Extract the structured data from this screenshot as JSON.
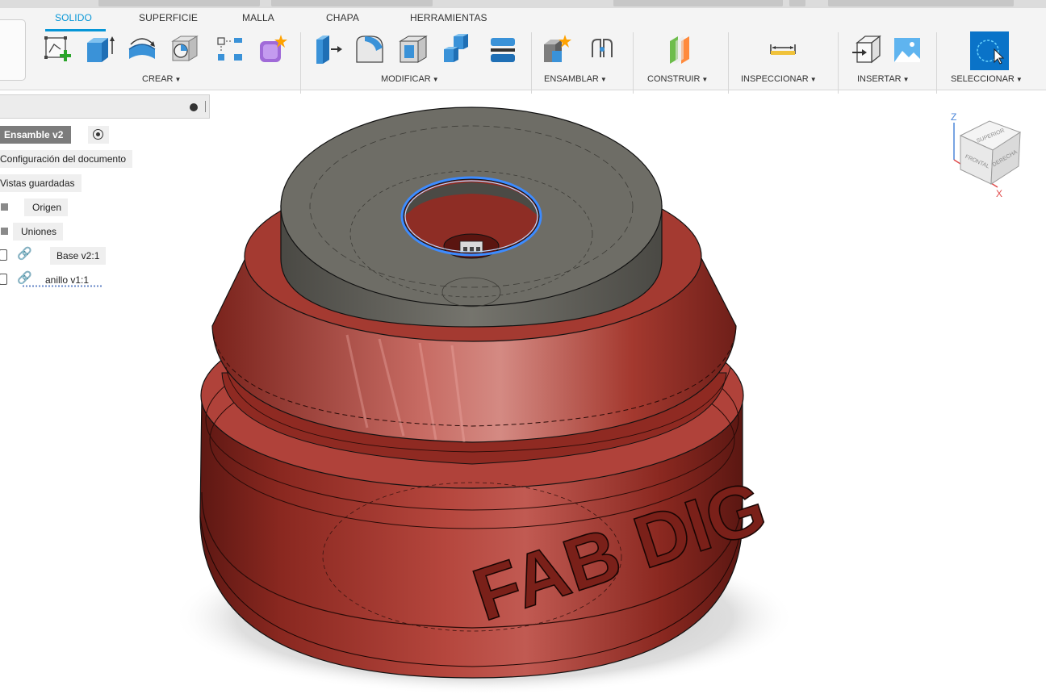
{
  "workspace_tabs": [
    "SOLIDO",
    "SUPERFICIE",
    "MALLA",
    "CHAPA",
    "HERRAMIENTAS"
  ],
  "active_tab": "SOLIDO",
  "groups": {
    "crear": "CREAR",
    "modificar": "MODIFICAR",
    "ensamblar": "ENSAMBLAR",
    "construir": "CONSTRUIR",
    "inspeccionar": "INSPECCIONAR",
    "insertar": "INSERTAR",
    "seleccionar": "SELECCIONAR"
  },
  "caret": "▼",
  "browser": {
    "root": "Ensamble v2",
    "items": {
      "config": "Configuración del documento",
      "views": "Vistas guardadas",
      "origin": "Origen",
      "joints": "Uniones",
      "base": "Base v2:1",
      "ring": "anillo v1:1"
    }
  },
  "viewcube": {
    "top": "SUPERIOR",
    "front": "FRONTAL",
    "right": "DERECHA",
    "axis_z": "Z",
    "axis_x": "X"
  },
  "model": {
    "embossed_text": "FAB DIG"
  },
  "colors": {
    "accent": "#0696d7",
    "body_red": "#9b2c23",
    "insert_gray": "#6e6d66",
    "selection_blue": "#3d8bff"
  }
}
